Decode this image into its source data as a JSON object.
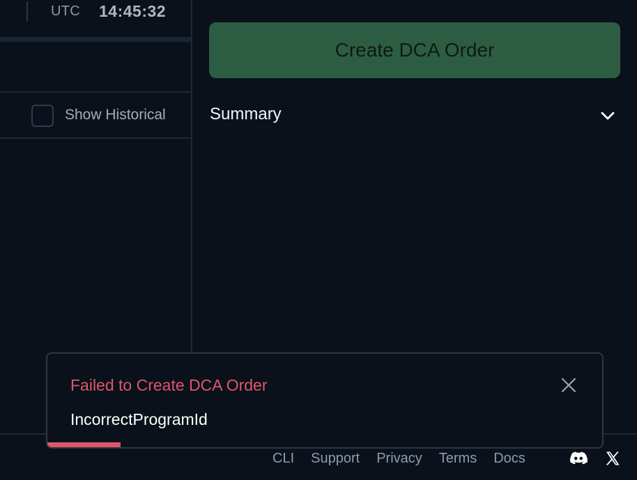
{
  "clock": {
    "timezone": "UTC",
    "time": "14:45:32"
  },
  "orders_panel": {
    "show_historical_label": "Show Historical",
    "show_historical_checked": false
  },
  "form": {
    "create_button_label": "Create DCA Order",
    "summary_label": "Summary",
    "summary_expand_icon": "chevron-down-icon"
  },
  "toast": {
    "title": "Failed to Create DCA Order",
    "message": "IncorrectProgramId",
    "close_icon": "close-icon",
    "progress_fraction": 0.132
  },
  "footer": {
    "links": [
      "CLI",
      "Support",
      "Privacy",
      "Terms",
      "Docs"
    ],
    "social_icons": [
      "discord-icon",
      "x-icon"
    ]
  },
  "colors": {
    "background": "#0a111a",
    "accent_button": "#2c5d43",
    "error": "#e0566c",
    "border": "#1d2a38"
  }
}
